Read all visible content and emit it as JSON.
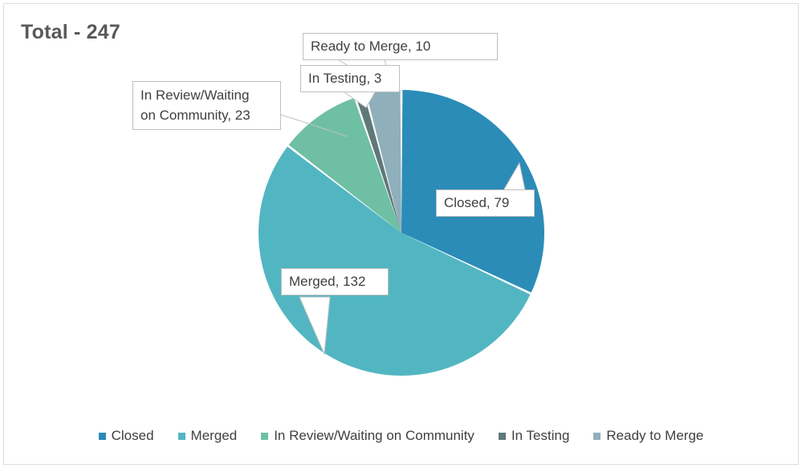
{
  "chart": {
    "title": "Total - 247",
    "background_color": "#FFFFFF",
    "border_color": "#DCDCDC",
    "text_color": "#404040",
    "title_color": "#595959"
  },
  "chart_data": {
    "type": "pie",
    "title": "Total - 247",
    "total": 247,
    "categories": [
      "Closed",
      "Merged",
      "In Review/Waiting on Community",
      "In Testing",
      "Ready to Merge"
    ],
    "values": [
      79,
      132,
      23,
      3,
      10
    ],
    "colors": [
      "#2B8CB8",
      "#52B6C2",
      "#6FBFA5",
      "#5F7878",
      "#8FAFBA"
    ],
    "data_labels": [
      "Closed, 79",
      "Merged, 132",
      "In Review/Waiting on Community, 23",
      "In Testing, 3",
      "Ready to Merge, 10"
    ],
    "start_angle_deg": 0,
    "direction": "clockwise",
    "slice_gap": true,
    "legend_position": "bottom",
    "grid": false,
    "xlabel": "",
    "ylabel": ""
  },
  "labels": {
    "ready_to_merge": "Ready to Merge, 10",
    "in_testing": "In Testing, 3",
    "in_review_line1": "In Review/Waiting",
    "in_review_line2": "on Community, 23",
    "closed": "Closed, 79",
    "merged": "Merged, 132"
  },
  "legend": {
    "items": [
      {
        "label": "Closed",
        "color": "#2B8CB8"
      },
      {
        "label": "Merged",
        "color": "#52B6C2"
      },
      {
        "label": "In Review/Waiting on Community",
        "color": "#6FBFA5"
      },
      {
        "label": "In Testing",
        "color": "#5F7878"
      },
      {
        "label": "Ready to Merge",
        "color": "#8FAFBA"
      }
    ]
  }
}
